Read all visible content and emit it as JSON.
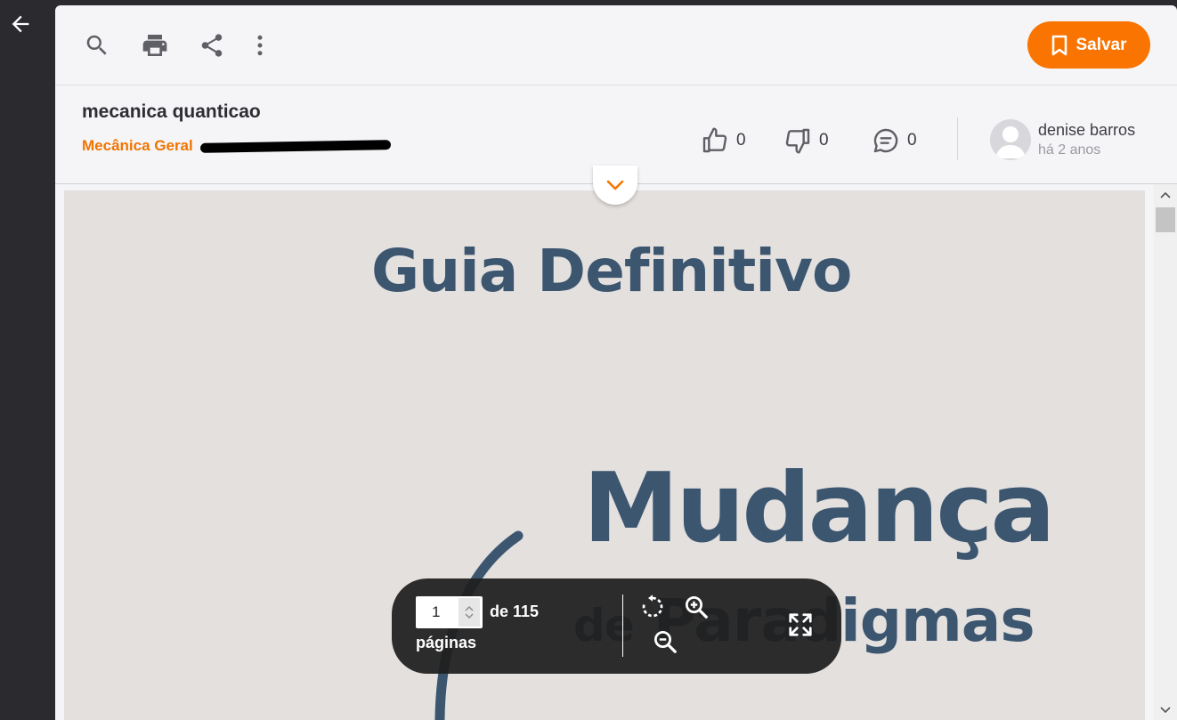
{
  "colors": {
    "accent": "#f97400",
    "link": "#f07500",
    "page_text": "#3c5670"
  },
  "nav": {
    "back_icon": "arrow-left-icon"
  },
  "toolbar": {
    "icons": [
      "search-icon",
      "print-icon",
      "share-icon",
      "more-vertical-icon"
    ],
    "save_label": "Salvar"
  },
  "document": {
    "title": "mecanica quanticao",
    "category": "Mecânica Geral",
    "likes": "0",
    "dislikes": "0",
    "comments": "0",
    "author_name": "denise barros",
    "author_time": "há 2 anos"
  },
  "page_content": {
    "heading": "Guia Definitivo",
    "big_word": "Mudança",
    "sub_prefix": "de",
    "sub_word": "Paradigmas"
  },
  "pager": {
    "current_page": "1",
    "total_label": "de 115",
    "pages_label": "páginas"
  }
}
